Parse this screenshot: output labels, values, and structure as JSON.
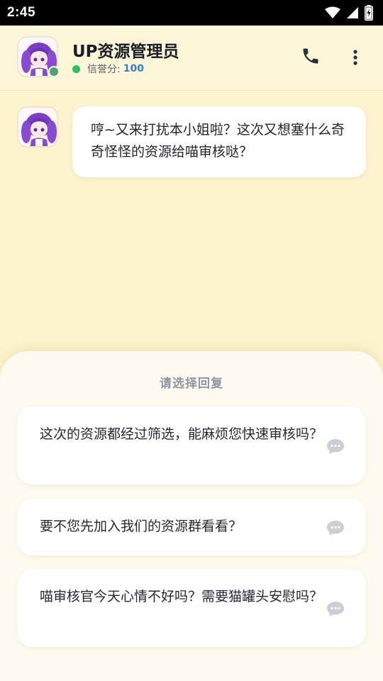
{
  "status_bar": {
    "time": "2:45",
    "icons": [
      "wifi-icon",
      "signal-icon",
      "battery-charging-icon"
    ]
  },
  "header": {
    "title": "UP资源管理员",
    "reputation_label": "信誉分:",
    "reputation_value": "100",
    "online_color": "#22c55e",
    "icons": [
      "phone-icon",
      "more-vertical-icon"
    ]
  },
  "chat": {
    "messages": [
      {
        "sender": "avatar",
        "text": "哼~又来打扰本小姐啦？这次又想塞什么奇奇怪怪的资源给喵审核哒？"
      }
    ]
  },
  "reply_sheet": {
    "title": "请选择回复",
    "options": [
      {
        "text": "这次的资源都经过筛选，能麻烦您快速审核吗？",
        "icon": "chat-bubble-icon"
      },
      {
        "text": "要不您先加入我们的资源群看看？",
        "icon": "chat-bubble-icon"
      },
      {
        "text": "喵审核官今天心情不好吗？需要猫罐头安慰吗？",
        "icon": "chat-bubble-icon"
      }
    ]
  },
  "colors": {
    "background": "#fdf3cf",
    "accent_blue": "#2f7fd6",
    "sheet_background": "#fffbf0"
  }
}
